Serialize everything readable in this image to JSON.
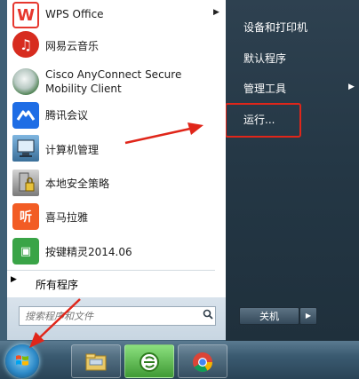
{
  "programs": [
    {
      "label": "WPS Office",
      "icon": "wps-icon",
      "glyph": "W"
    },
    {
      "label": "网易云音乐",
      "icon": "netease-music-icon",
      "glyph": "♫"
    },
    {
      "label": "Cisco AnyConnect Secure Mobility Client",
      "line1": "Cisco AnyConnect Secure",
      "line2": "Mobility Client",
      "icon": "cisco-globe-icon"
    },
    {
      "label": "腾讯会议",
      "icon": "tencent-meeting-icon",
      "glyph": "◢◣"
    },
    {
      "label": "计算机管理",
      "icon": "computer-management-icon"
    },
    {
      "label": "本地安全策略",
      "icon": "security-policy-icon"
    },
    {
      "label": "喜马拉雅",
      "icon": "ximalaya-icon",
      "glyph": "听"
    },
    {
      "label": "按键精灵2014.06",
      "icon": "anjian-icon",
      "glyph": "▣"
    }
  ],
  "all_programs": "所有程序",
  "search": {
    "placeholder": "搜索程序和文件"
  },
  "right_menu": {
    "devices": "设备和打印机",
    "default_programs": "默认程序",
    "admin_tools": "管理工具",
    "run": "运行..."
  },
  "shutdown": {
    "label": "关机",
    "arrow": "▶"
  },
  "colors": {
    "highlight": "#e0261a",
    "panel_bg": "#ffffff",
    "right_panel": "#243745"
  },
  "taskbar": [
    "windows-explorer-icon",
    "ie-icon",
    "chrome-icon"
  ]
}
